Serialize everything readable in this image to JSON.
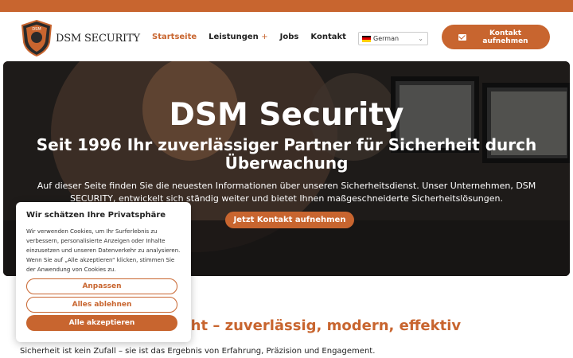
{
  "colors": {
    "accent": "#c8652f",
    "text": "#222222"
  },
  "header": {
    "logo_text": "DSM SECURITY",
    "logo_badge_text": "DSM",
    "nav": {
      "startseite": "Startseite",
      "leistungen": "Leistungen",
      "leistungen_plus": "+",
      "jobs": "Jobs",
      "kontakt": "Kontakt"
    },
    "language": {
      "selected": "German",
      "flag_icon": "german-flag-icon"
    },
    "contact_button": "Kontakt aufnehmen",
    "contact_icon": "envelope-icon"
  },
  "hero": {
    "title": "DSM Security",
    "subtitle": "Seit 1996 Ihr zuverlässiger Partner für Sicherheit durch Überwachung",
    "text": "Auf dieser Seite finden Sie die neuesten Informationen über unseren Sicherheitsdienst. Unser Unternehmen, DSM SECURITY, entwickelt sich ständig weiter und bietet Ihnen maßgeschneiderte Sicherheitslösungen.",
    "button": "Jetzt Kontakt aufnehmen"
  },
  "section": {
    "title": "Sicherheit neu gedacht – zuverlässig, modern, effektiv",
    "text": "Sicherheit ist kein Zufall – sie ist das Ergebnis von Erfahrung, Präzision und Engagement."
  },
  "cookie": {
    "title": "Wir schätzen Ihre Privatsphäre",
    "text": "Wir verwenden Cookies, um Ihr Surferlebnis zu verbessern, personalisierte Anzeigen oder Inhalte einzusetzen und unseren Datenverkehr zu analysieren. Wenn Sie auf „Alle akzeptieren“ klicken, stimmen Sie der Anwendung von Cookies zu.",
    "customize": "Anpassen",
    "reject": "Alles ablehnen",
    "accept": "Alle akzeptieren"
  }
}
